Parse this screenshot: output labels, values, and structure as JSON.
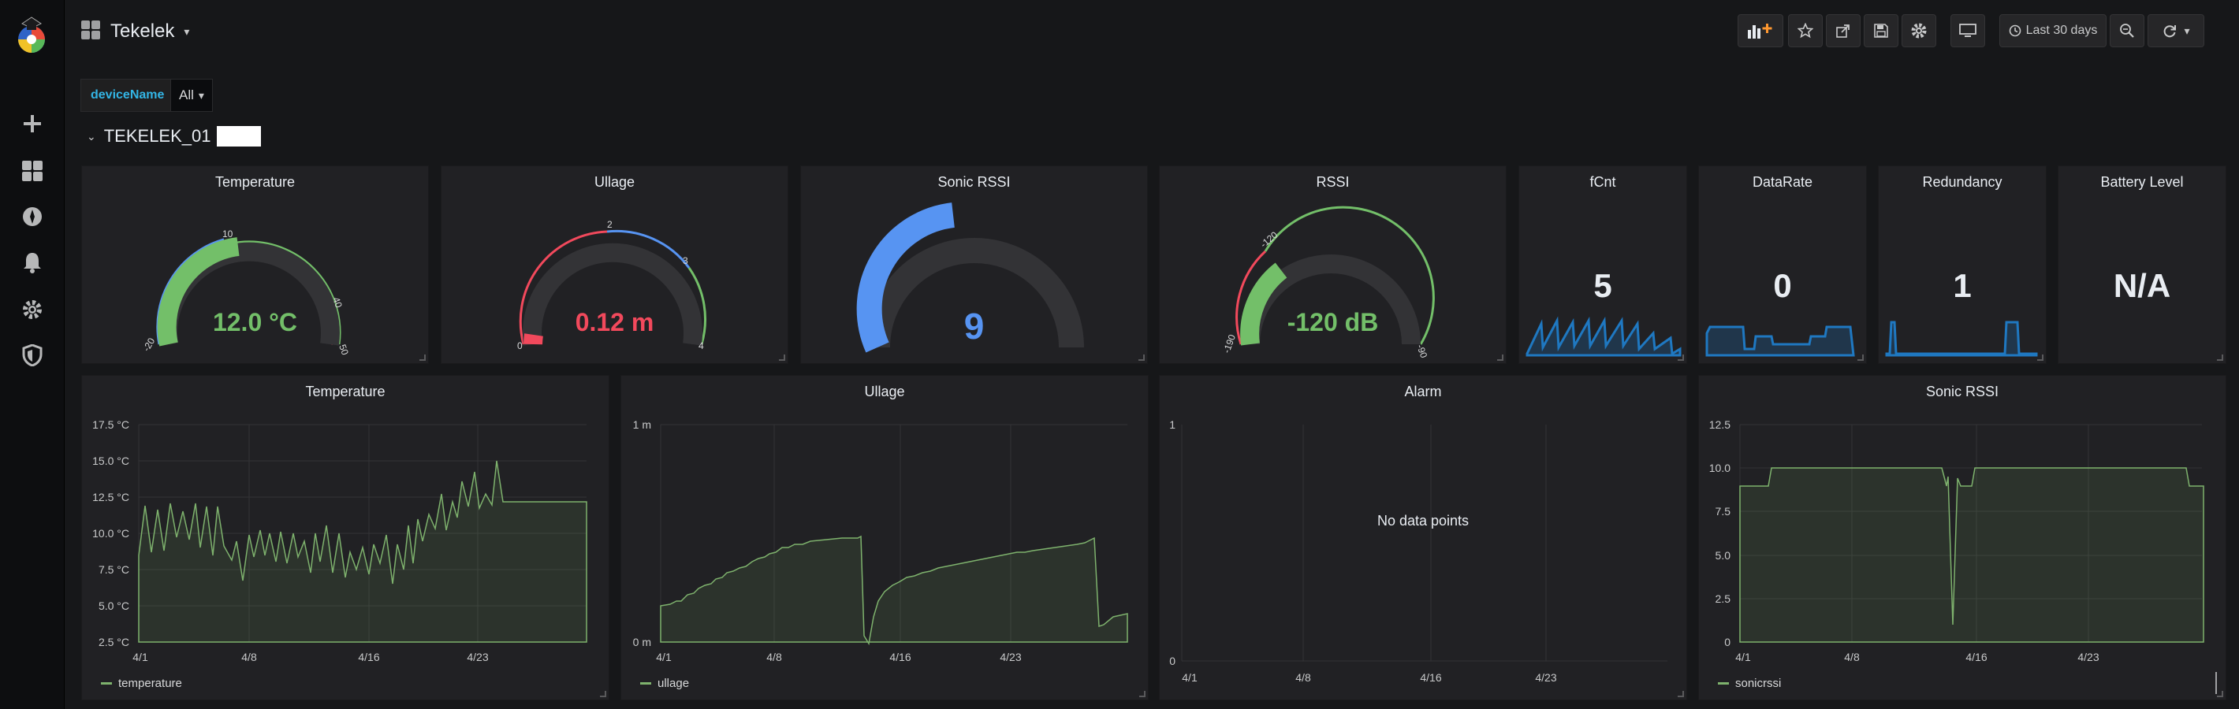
{
  "topbar": {
    "title": "Tekelek",
    "time_range": "Last 30 days"
  },
  "variables": {
    "label": "deviceName",
    "value": "All"
  },
  "row": {
    "title": "TEKELEK_01"
  },
  "gauges": [
    {
      "title": "Temperature",
      "value": "12.0 °C",
      "color": "#73bf69",
      "ticks": [
        "-20",
        "10",
        "40",
        "50"
      ]
    },
    {
      "title": "Ullage",
      "value": "0.12 m",
      "color": "#f2495c",
      "ticks": [
        "0",
        "2",
        "3",
        "4"
      ]
    },
    {
      "title": "Sonic RSSI",
      "value": "9",
      "color": "#5794f2",
      "ticks": []
    },
    {
      "title": "RSSI",
      "value": "-120 dB",
      "color": "#73bf69",
      "ticks": [
        "-190",
        "-120",
        "-90"
      ]
    }
  ],
  "stats": [
    {
      "title": "fCnt",
      "value": "5"
    },
    {
      "title": "DataRate",
      "value": "0"
    },
    {
      "title": "Redundancy",
      "value": "1"
    },
    {
      "title": "Battery Level",
      "value": "N/A"
    }
  ],
  "graphs": {
    "temperature": {
      "title": "Temperature",
      "legend": "temperature",
      "yticks": [
        "17.5 °C",
        "15.0 °C",
        "12.5 °C",
        "10.0 °C",
        "7.5 °C",
        "5.0 °C",
        "2.5 °C"
      ],
      "xticks": [
        "4/1",
        "4/8",
        "4/16",
        "4/23"
      ]
    },
    "ullage": {
      "title": "Ullage",
      "legend": "ullage",
      "yticks": [
        "1 m",
        "0 m"
      ],
      "xticks": [
        "4/1",
        "4/8",
        "4/16",
        "4/23"
      ]
    },
    "alarm": {
      "title": "Alarm",
      "nodata": "No data points",
      "yticks": [
        "1",
        "0"
      ],
      "xticks": [
        "4/1",
        "4/8",
        "4/16",
        "4/23"
      ]
    },
    "sonic": {
      "title": "Sonic RSSI",
      "legend": "sonicrssi",
      "yticks": [
        "12.5",
        "10.0",
        "7.5",
        "5.0",
        "2.5",
        "0"
      ],
      "xticks": [
        "4/1",
        "4/8",
        "4/16",
        "4/23"
      ]
    }
  },
  "colors": {
    "green": "#73bf69",
    "red": "#f2495c",
    "blue": "#5794f2",
    "spark": "#1f78c1",
    "variable": "#33b5e5"
  }
}
